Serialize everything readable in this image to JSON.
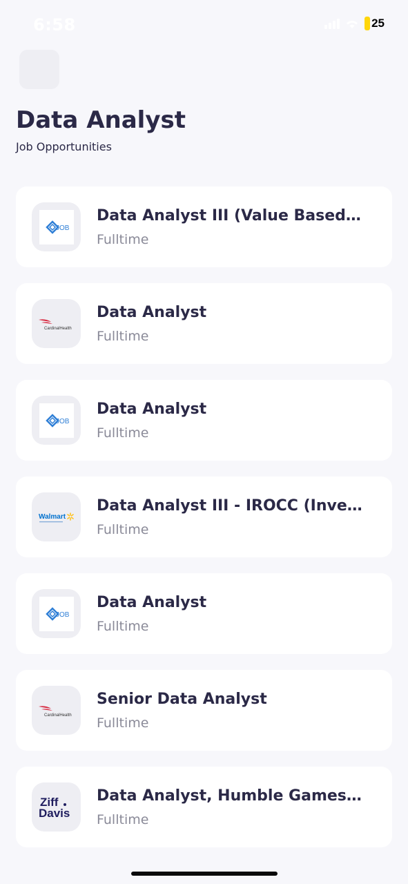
{
  "status_bar": {
    "time": "6:58",
    "battery": "25",
    "battery_color": "#ffd60a"
  },
  "header": {
    "title": "Data Analyst",
    "subtitle": "Job Opportunities"
  },
  "jobs": [
    {
      "title": "Data Analyst III (Value Based Con...",
      "type": "Fulltime",
      "logo": "job-logo-icon"
    },
    {
      "title": "Data Analyst",
      "type": "Fulltime",
      "logo": "cardinal-health-logo",
      "logo_text": "CardinalHealth"
    },
    {
      "title": "Data Analyst",
      "type": "Fulltime",
      "logo": "job-logo-icon"
    },
    {
      "title": "Data Analyst III - IROCC (Investig...",
      "type": "Fulltime",
      "logo": "walmart-logo",
      "logo_text": "Walmart"
    },
    {
      "title": "Data Analyst",
      "type": "Fulltime",
      "logo": "job-logo-icon"
    },
    {
      "title": "Senior Data Analyst",
      "type": "Fulltime",
      "logo": "cardinal-health-logo",
      "logo_text": "CardinalHealth"
    },
    {
      "title": "Data Analyst, Humble Games Pu...",
      "type": "Fulltime",
      "logo": "ziff-davis-logo",
      "logo_text": "Ziff Davis"
    }
  ],
  "colors": {
    "background": "#f7f7fb",
    "card": "#ffffff",
    "title_text": "#2b2947",
    "muted_text": "#8a8a98",
    "logo_bg": "#eeeef3",
    "job_logo_blue": "#2f7fd6",
    "cardinal_red": "#d7263d",
    "walmart_blue": "#0071ce",
    "walmart_yellow": "#ffc220",
    "ziff_navy": "#1f1d5e"
  }
}
